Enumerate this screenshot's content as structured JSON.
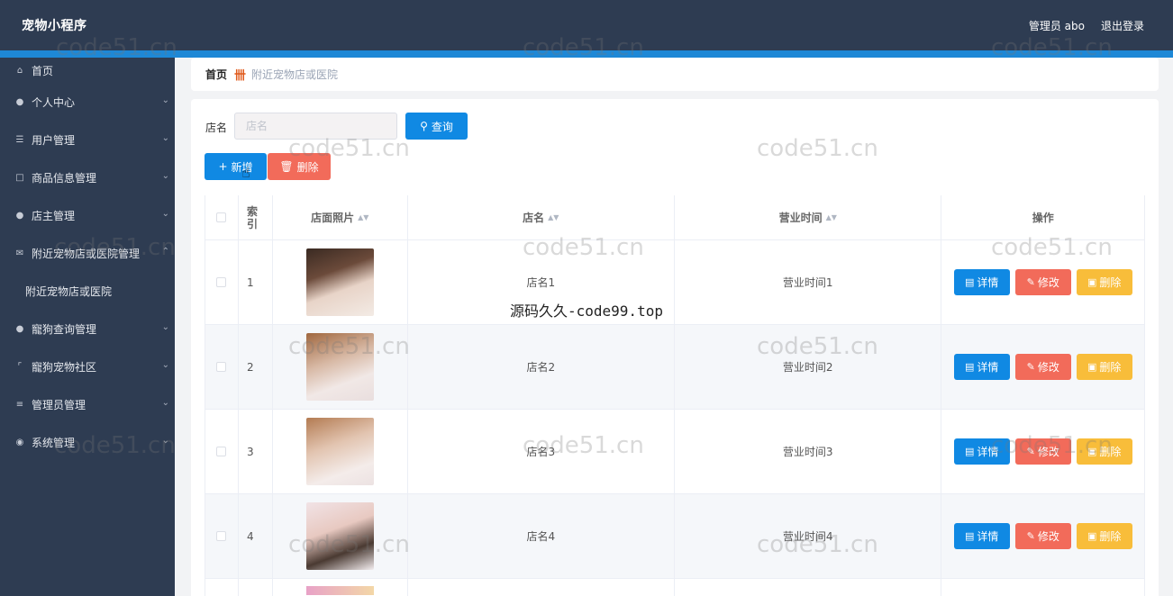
{
  "header": {
    "app_title": "宠物小程序",
    "user_info": "管理员 abo",
    "logout_label": "退出登录"
  },
  "sidebar": {
    "items": [
      {
        "label": "首页",
        "icon": "home-icon",
        "has_arrow": false
      },
      {
        "label": "个人中心",
        "icon": "user-icon",
        "has_arrow": true
      },
      {
        "label": "用户管理",
        "icon": "list-icon",
        "has_arrow": true
      },
      {
        "label": "商品信息管理",
        "icon": "message-icon",
        "has_arrow": true
      },
      {
        "label": "店主管理",
        "icon": "user-icon",
        "has_arrow": true
      },
      {
        "label": "附近宠物店或医院管理",
        "icon": "mail-icon",
        "has_arrow": true,
        "expanded": true
      },
      {
        "label": "附近宠物店或医院",
        "sub": true
      },
      {
        "label": "寵狗查询管理",
        "icon": "user-icon",
        "has_arrow": true
      },
      {
        "label": "寵狗宠物社区",
        "icon": "crop-icon",
        "has_arrow": true
      },
      {
        "label": "管理员管理",
        "icon": "sliders-icon",
        "has_arrow": true
      },
      {
        "label": "系统管理",
        "icon": "globe-icon",
        "has_arrow": true
      }
    ]
  },
  "breadcrumb": {
    "home": "首页",
    "current": "附近宠物店或医院"
  },
  "search": {
    "label": "店名",
    "placeholder": "店名",
    "query_button": "查询"
  },
  "actions": {
    "add_label": "新增",
    "delete_label": "删除"
  },
  "table": {
    "headers": {
      "index": "索\n引",
      "image": "店面照片",
      "name": "店名",
      "hours": "营业时间",
      "ops": "操作"
    },
    "rows": [
      {
        "index": "1",
        "name": "店名1",
        "hours": "营业时间1"
      },
      {
        "index": "2",
        "name": "店名2",
        "hours": "营业时间2"
      },
      {
        "index": "3",
        "name": "店名3",
        "hours": "营业时间3"
      },
      {
        "index": "4",
        "name": "店名4",
        "hours": "营业时间4"
      }
    ],
    "op_labels": {
      "detail": "详情",
      "edit": "修改",
      "delete": "删除"
    }
  },
  "overlay_text": "源码久久-code99.top",
  "watermark": "code51.cn",
  "colors": {
    "topbar": "#2e3c52",
    "accent": "#1e88d6",
    "primary": "#1089e3",
    "danger": "#f26b5a",
    "warning": "#f8bd3a"
  }
}
